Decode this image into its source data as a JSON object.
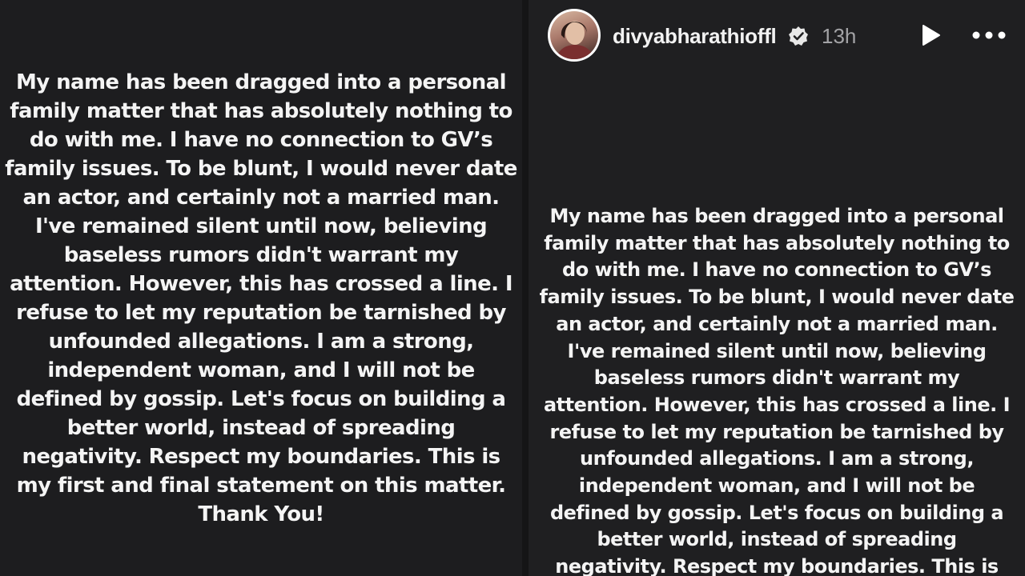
{
  "left_post": {
    "statement_lines": [
      "My name has been dragged into a personal",
      "family matter that has absolutely nothing to",
      "do with me. I have no connection to GV’s",
      "family issues. To be blunt, I would never date",
      "an actor, and certainly not a married man.",
      "I've remained silent until now, believing",
      "baseless rumors didn't warrant my",
      "attention. However, this has crossed a line. I",
      "refuse to let my reputation be tarnished by",
      "unfounded allegations. I am a strong,",
      "independent woman, and I will not be",
      "defined by gossip. Let's focus on building a",
      "better world, instead of spreading",
      "negativity. Respect my boundaries. This is",
      "my first and final statement on this matter.",
      "Thank You!"
    ]
  },
  "right_post": {
    "header": {
      "username": "divyabharathioffl",
      "time": "13h",
      "verified_icon": "verified-badge-icon",
      "play_icon": "play-icon",
      "more_icon": "more-dots-icon"
    },
    "statement_lines": [
      "My name has been dragged into a personal",
      "family matter that has absolutely nothing to",
      "do with me. I have no connection to GV’s",
      "family issues. To be blunt, I would never date",
      "an actor, and certainly not a married man.",
      "I've remained silent until now, believing",
      "baseless rumors didn't warrant my",
      "attention. However, this has crossed a line. I",
      "refuse to let my reputation be tarnished by",
      "unfounded allegations. I am a strong,",
      "independent woman, and I will not be",
      "defined by gossip. Let's focus on building a",
      "better world, instead of spreading",
      "negativity. Respect my boundaries. This is"
    ]
  },
  "colors": {
    "background": "#1d1d1f",
    "text": "#f4f4f4",
    "muted": "#a3a3a6"
  }
}
